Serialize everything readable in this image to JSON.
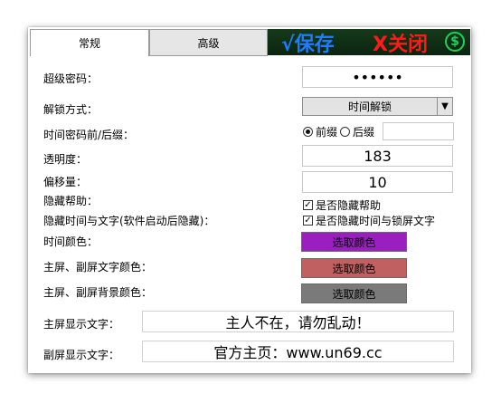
{
  "tabs": {
    "general": "常规",
    "advanced": "高级"
  },
  "toolbar": {
    "save_label": "√保存",
    "close_label": "X关闭",
    "dollar_icon_text": "$"
  },
  "settings": {
    "password_label": "超级密码：",
    "password_value": "••••••",
    "unlock_method_label": "解锁方式：",
    "unlock_method_value": "时间解锁",
    "time_password_label": "时间密码前/后缀：",
    "prefix_label": "前缀",
    "suffix_label": "后缀",
    "suffix_value": "",
    "transparency_label": "透明度：",
    "transparency_value": "183",
    "offset_label": "偏移量：",
    "offset_value": "10",
    "hide_help_label": "隐藏帮助：",
    "hide_help_check_label": "是否隐藏帮助",
    "hide_time_label": "隐藏时间与文字(软件启动后隐藏)：",
    "hide_time_check_label": "是否隐藏时间与锁屏文字",
    "time_color_label": "时间颜色：",
    "main_text_color_label": "主屏、副屏文字颜色：",
    "main_bg_color_label": "主屏、副屏背景颜色：",
    "pick_color_label": "选取颜色",
    "main_text_label": "主屏显示文字：",
    "main_text_value": "主人不在，请勿乱动！",
    "sub_text_label": "副屏显示文字：",
    "sub_text_value": "官方主页：www.un69.cc"
  },
  "colors": {
    "time_color": "#9b1fc0",
    "text_color": "#c06060",
    "bg_color": "#7a7a7a",
    "save": "#1e7cff",
    "close": "#ff1a1a",
    "toolbar_bg": "#0f2a14"
  },
  "state": {
    "prefix_selected": true,
    "hide_help_checked": true,
    "hide_time_checked": true
  }
}
